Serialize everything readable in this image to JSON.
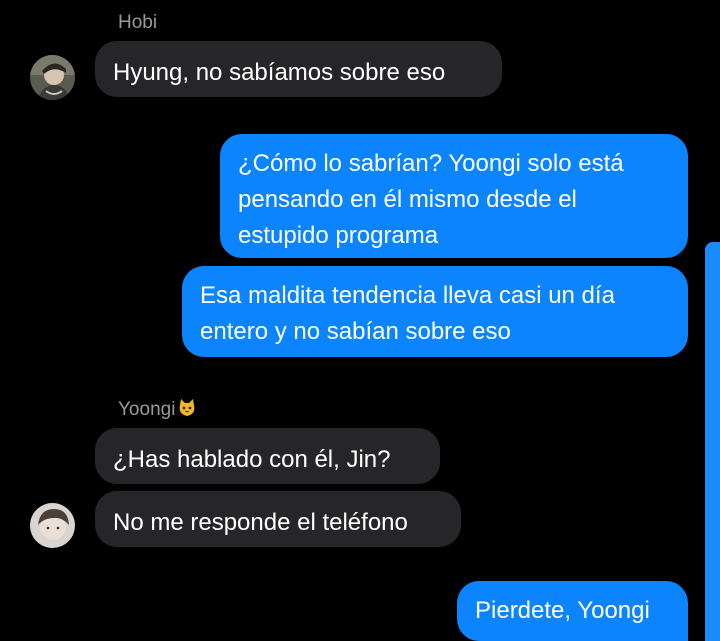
{
  "colors": {
    "background": "#000000",
    "incoming_bubble": "#262628",
    "outgoing_bubble": "#0b84fe",
    "sender_name": "#9a9a9e",
    "scrollbar": "#1a8cff"
  },
  "messages": [
    {
      "direction": "incoming",
      "sender": "Hobi",
      "lines": [
        "Hyung, no sabíamos sobre eso"
      ]
    },
    {
      "direction": "outgoing",
      "lines": [
        "¿Cómo lo sabrían? Yoongi solo está",
        "pensando en él mismo desde el",
        "estupido programa"
      ]
    },
    {
      "direction": "outgoing",
      "lines": [
        "Esa maldita tendencia lleva casi un día",
        "entero y no sabían sobre eso"
      ]
    },
    {
      "direction": "incoming",
      "sender": "Yoongi",
      "sender_emoji": "cat-face-icon",
      "lines": [
        "¿Has hablado con él, Jin?"
      ]
    },
    {
      "direction": "incoming",
      "lines": [
        "No me responde el teléfono"
      ]
    },
    {
      "direction": "outgoing",
      "lines": [
        "Pierdete, Yoongi"
      ]
    }
  ]
}
